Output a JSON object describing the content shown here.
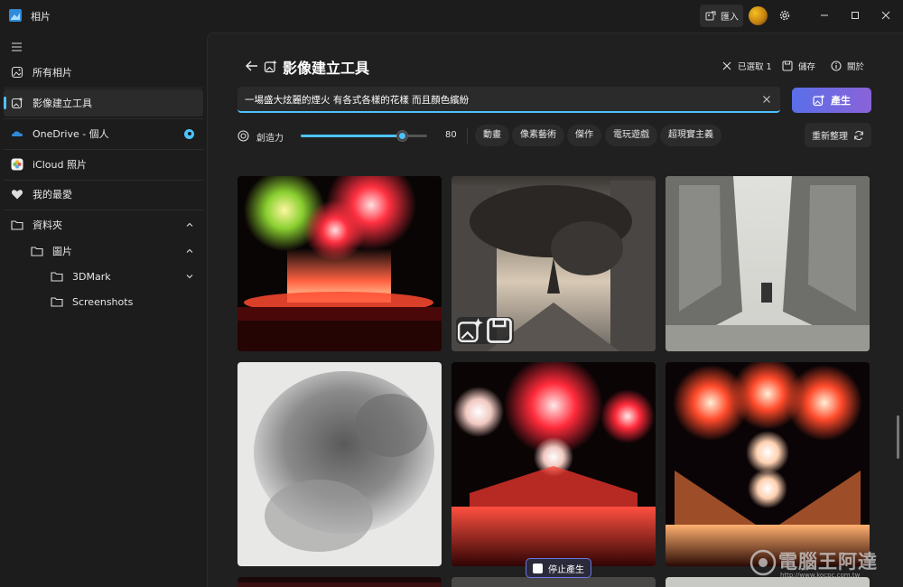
{
  "app": {
    "title": "相片"
  },
  "titlebar": {
    "import_label": "匯入"
  },
  "sidebar": {
    "items": [
      {
        "label": "所有相片"
      },
      {
        "label": "影像建立工具"
      },
      {
        "label": "OneDrive - 個人"
      },
      {
        "label": "iCloud 照片"
      },
      {
        "label": "我的最愛"
      },
      {
        "label": "資料夾"
      },
      {
        "label": "圖片"
      },
      {
        "label": "3DMark"
      },
      {
        "label": "Screenshots"
      }
    ]
  },
  "header": {
    "title": "影像建立工具",
    "selected_label": "已選取 1",
    "save_label": "儲存",
    "about_label": "關於"
  },
  "prompt": {
    "value": "一場盛大炫麗的煙火 有各式各樣的花樣 而且顏色繽紛"
  },
  "generate_label": "產生",
  "creativity": {
    "label": "創造力",
    "value": 80
  },
  "styles": [
    "動畫",
    "像素藝術",
    "傑作",
    "電玩遊戲",
    "超現實主義"
  ],
  "regenerate_label": "重新整理",
  "stop_label": "停止產生",
  "colors": {
    "accent": "#4cc2ff",
    "generate_start": "#5a6fe8",
    "generate_end": "#8a63d9"
  },
  "watermark": {
    "text": "電腦王阿達",
    "url": "http://www.kocpc.com.tw"
  }
}
